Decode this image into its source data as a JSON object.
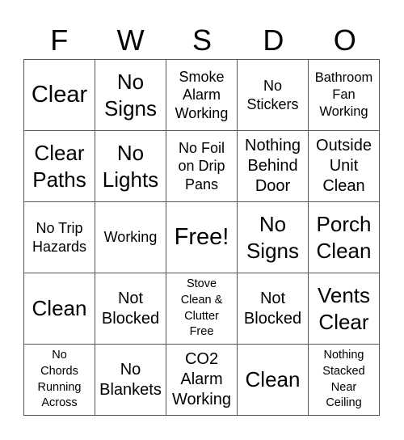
{
  "header": {
    "letters": [
      "F",
      "W",
      "S",
      "D",
      "O"
    ]
  },
  "board": {
    "rows": [
      [
        {
          "text": "Clear",
          "size": "xl"
        },
        {
          "text": "No\nSigns",
          "size": "l"
        },
        {
          "text": "Smoke\nAlarm\nWorking",
          "size": "m"
        },
        {
          "text": "No\nStickers",
          "size": "m"
        },
        {
          "text": "Bathroom\nFan\nWorking",
          "size": "s"
        }
      ],
      [
        {
          "text": "Clear\nPaths",
          "size": "l"
        },
        {
          "text": "No\nLights",
          "size": "l"
        },
        {
          "text": "No Foil\non Drip\nPans",
          "size": "m"
        },
        {
          "text": "Nothing\nBehind\nDoor",
          "size": "m2"
        },
        {
          "text": "Outside\nUnit\nClean",
          "size": "m2"
        }
      ],
      [
        {
          "text": "No Trip\nHazards",
          "size": "m"
        },
        {
          "text": "Working",
          "size": "m"
        },
        {
          "text": "Free!",
          "size": "xl"
        },
        {
          "text": "No\nSigns",
          "size": "l"
        },
        {
          "text": "Porch\nClean",
          "size": "l"
        }
      ],
      [
        {
          "text": "Clean",
          "size": "l"
        },
        {
          "text": "Not\nBlocked",
          "size": "m2"
        },
        {
          "text": "Stove\nClean &\nClutter\nFree",
          "size": "xs"
        },
        {
          "text": "Not\nBlocked",
          "size": "m2"
        },
        {
          "text": "Vents\nClear",
          "size": "l"
        }
      ],
      [
        {
          "text": "No\nChords\nRunning\nAcross",
          "size": "xs"
        },
        {
          "text": "No\nBlankets",
          "size": "m2"
        },
        {
          "text": "CO2\nAlarm\nWorking",
          "size": "m2"
        },
        {
          "text": "Clean",
          "size": "l"
        },
        {
          "text": "Nothing\nStacked\nNear\nCeiling",
          "size": "xs"
        }
      ]
    ]
  }
}
